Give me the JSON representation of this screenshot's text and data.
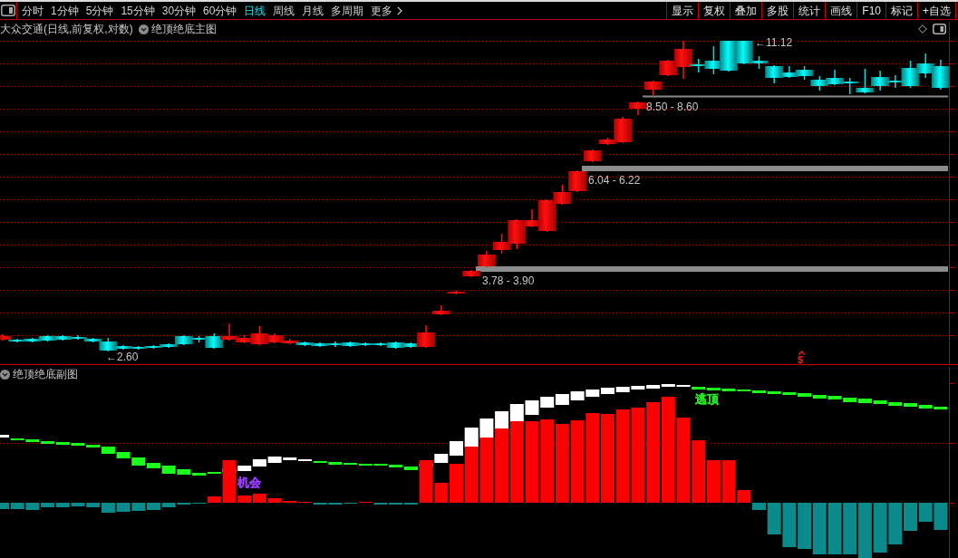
{
  "toolbar": {
    "period_tabs": [
      {
        "label": "分时",
        "selected": false
      },
      {
        "label": "1分钟",
        "selected": false
      },
      {
        "label": "5分钟",
        "selected": false
      },
      {
        "label": "15分钟",
        "selected": false
      },
      {
        "label": "30分钟",
        "selected": false
      },
      {
        "label": "60分钟",
        "selected": false
      },
      {
        "label": "日线",
        "selected": true
      },
      {
        "label": "周线",
        "selected": false
      },
      {
        "label": "月线",
        "selected": false
      },
      {
        "label": "多周期",
        "selected": false
      }
    ],
    "more_menu": "更多",
    "buttons": [
      "显示",
      "复权",
      "叠加",
      "多股",
      "统计",
      "画线",
      "F10",
      "标记",
      "+自选"
    ]
  },
  "main_chart": {
    "title": "大众交通(日线,前复权,对数)",
    "indicator": "绝顶绝底主图",
    "price_labels": [
      "←11.12",
      "8.50 - 8.60",
      "6.04 - 6.22",
      "3.78 - 3.90",
      "←2.60"
    ],
    "signal_marker": "$"
  },
  "sub_chart": {
    "indicator": "绝顶绝底副图",
    "signals": [
      {
        "text": "机会",
        "color": "#9a3cff"
      },
      {
        "text": "逃顶",
        "color": "#22e622"
      }
    ]
  }
}
